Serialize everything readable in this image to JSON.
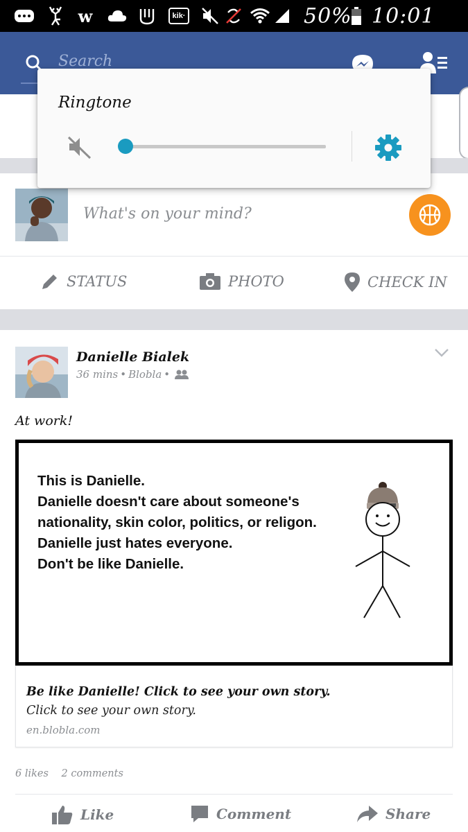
{
  "status_bar": {
    "battery": "50%",
    "time": "10:01 PM",
    "icons": [
      "notification-dots-icon",
      "deer-icon",
      "w-icon",
      "cloud-icon",
      "m-icon",
      "kik-icon",
      "mute-icon",
      "no-sync-icon",
      "wifi-icon",
      "signal-icon",
      "battery-icon"
    ],
    "kik_label": "kik·"
  },
  "header": {
    "search_placeholder": "Search",
    "bg_color": "#3b5998"
  },
  "composer": {
    "placeholder": "What's on your mind?",
    "actions": [
      {
        "label": "STATUS",
        "icon": "pencil-icon"
      },
      {
        "label": "PHOTO",
        "icon": "camera-icon"
      },
      {
        "label": "CHECK IN",
        "icon": "location-pin-icon"
      }
    ]
  },
  "post": {
    "author": "Danielle Bialek",
    "time": "36 mins",
    "app": "Blobla",
    "text": "At work!",
    "meme_lines": [
      "This is Danielle.",
      "Danielle doesn't care about someone's",
      "nationality, skin color, politics, or religon.",
      "Danielle just hates everyone.",
      "Don't be like Danielle."
    ],
    "link_title": "Be like Danielle! Click to see your own story.",
    "link_desc": "Click to see your own story.",
    "link_domain": "en.blobla.com",
    "likes": "6 likes",
    "comments": "2 comments",
    "footer_actions": [
      {
        "label": "Like",
        "icon": "thumbs-up-icon"
      },
      {
        "label": "Comment",
        "icon": "comment-icon"
      },
      {
        "label": "Share",
        "icon": "share-icon"
      }
    ]
  },
  "volume_popup": {
    "title": "Ringtone",
    "level": 0.0,
    "accent_color": "#1a9bc0"
  }
}
